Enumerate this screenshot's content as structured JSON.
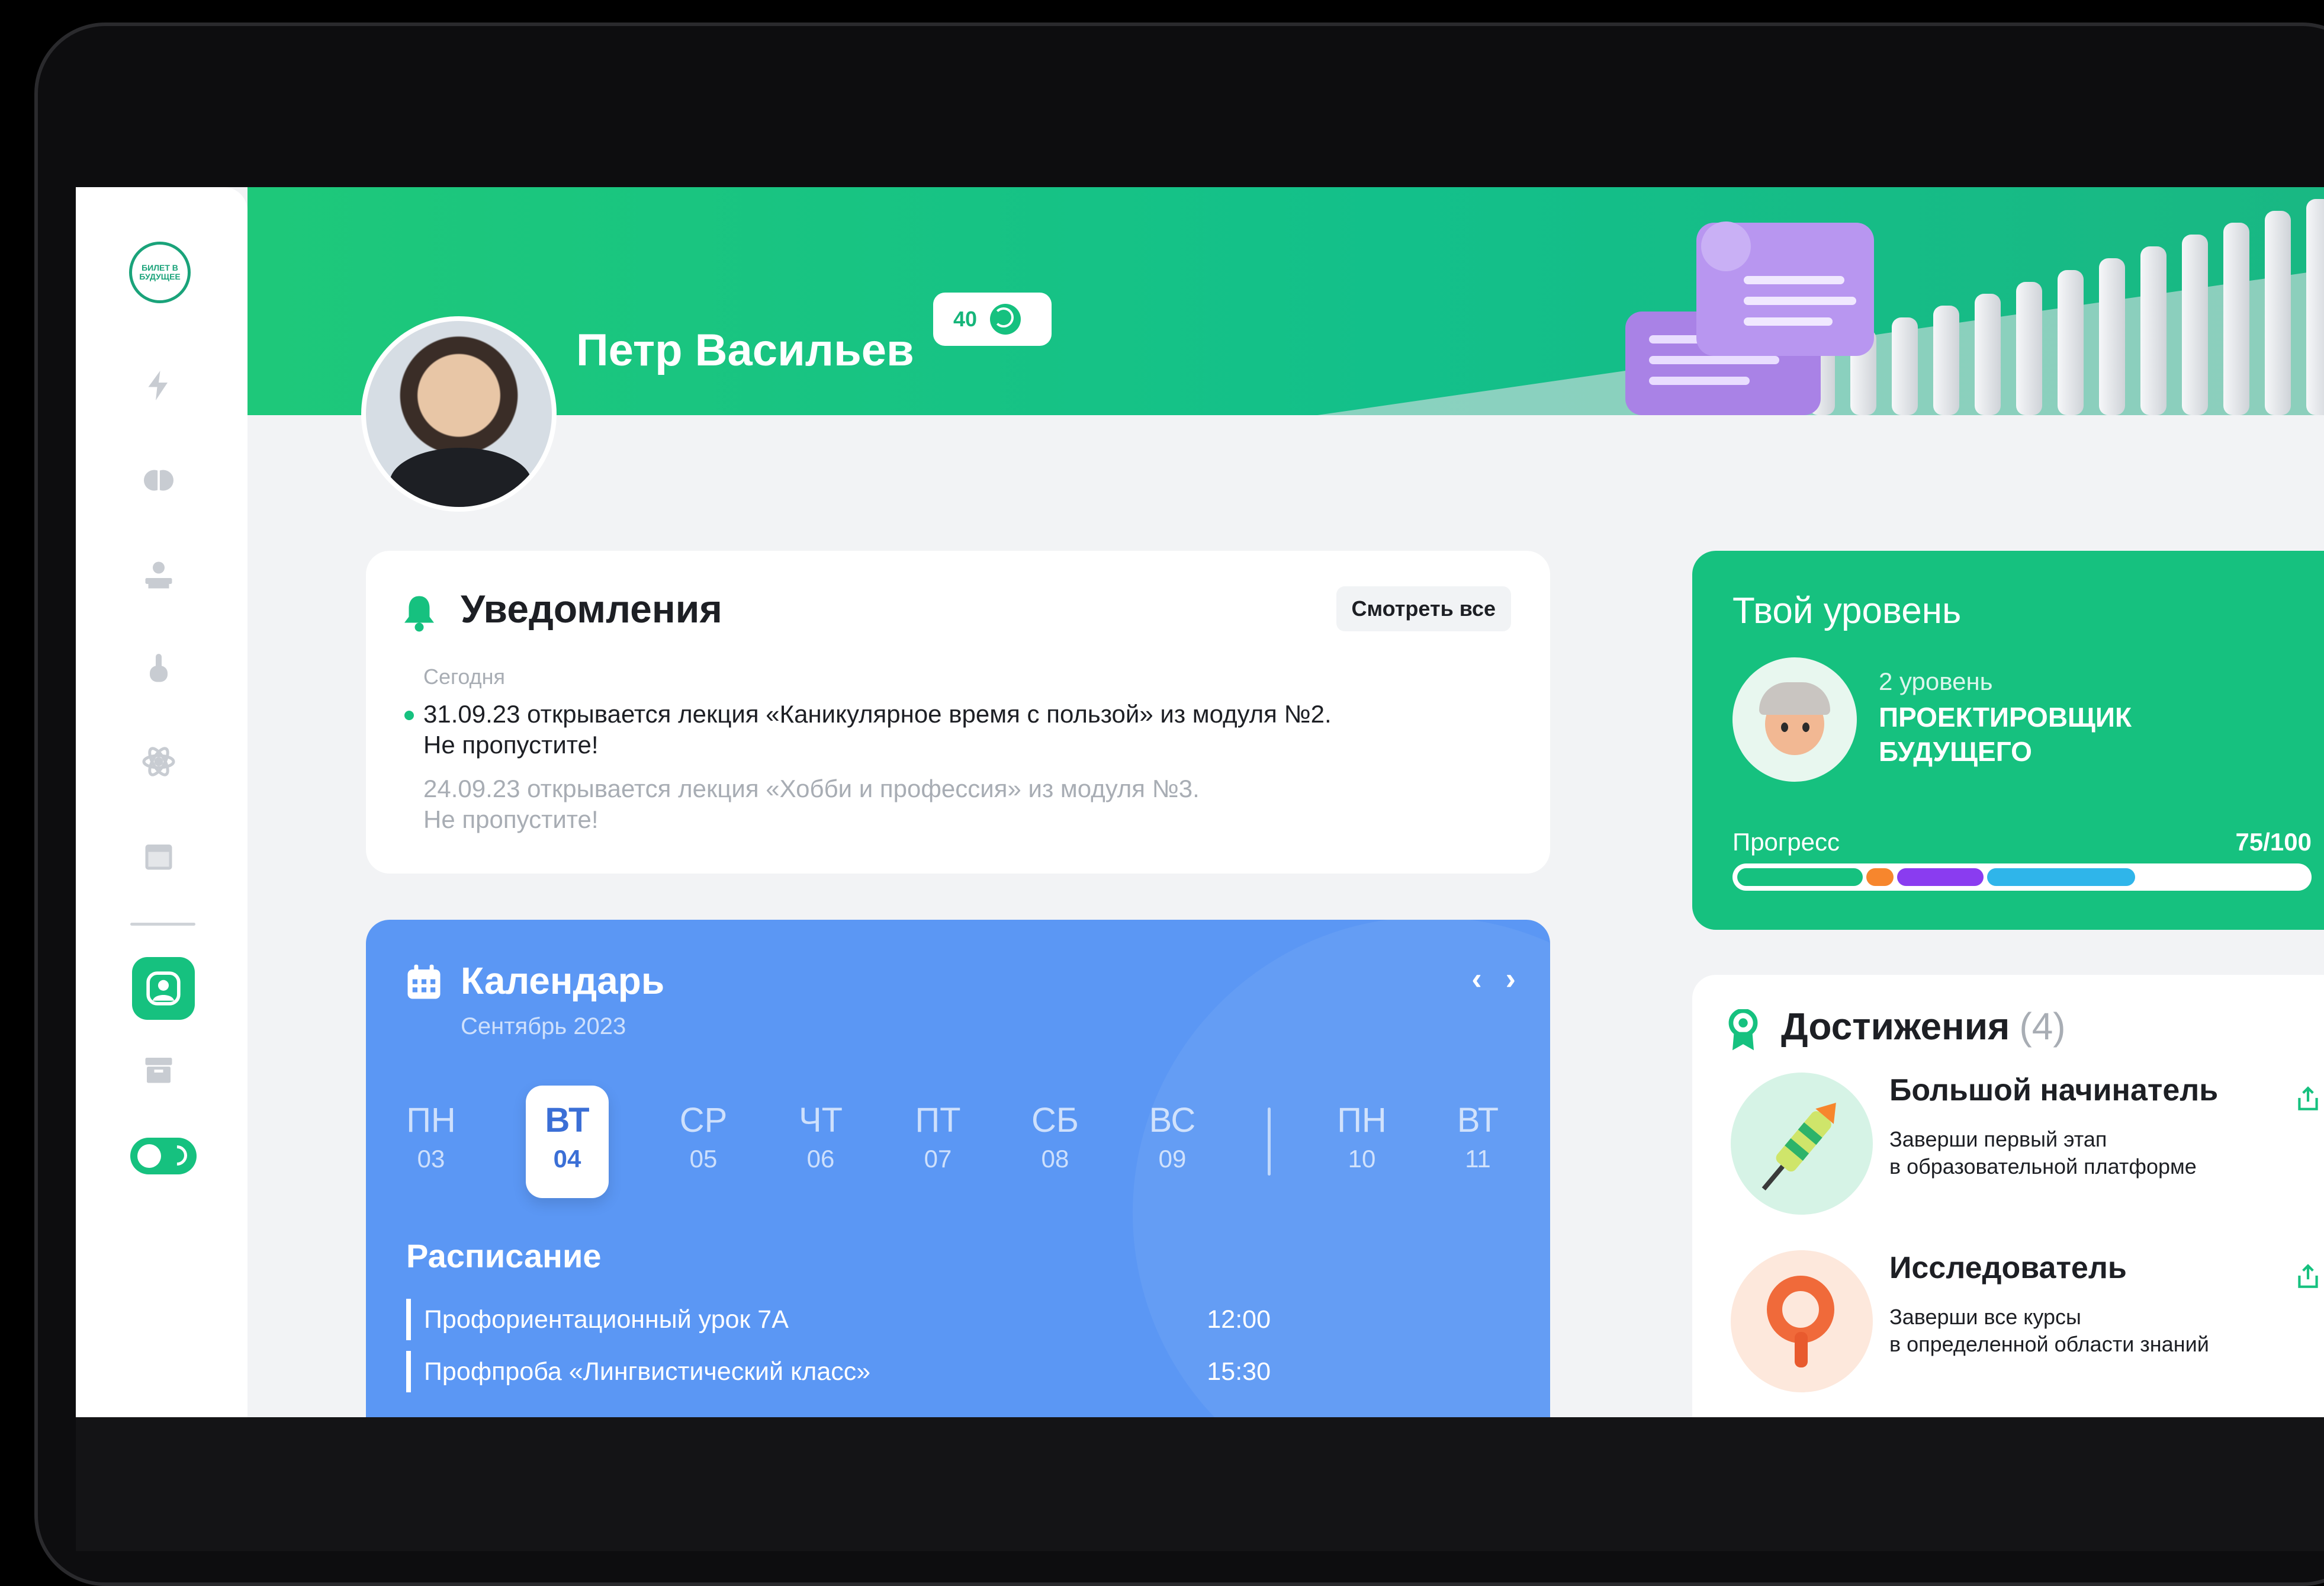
{
  "user": {
    "name": "Петр Васильев",
    "coins": "40"
  },
  "sidebar": {
    "logo": "БИЛЕТ В БУДУЩЕЕ",
    "icons": [
      "lightning-icon",
      "brain-icon",
      "pupil-icon",
      "hand-icon",
      "atom-icon",
      "calendar-icon",
      "profile-icon",
      "archive-icon",
      "theme-toggle"
    ]
  },
  "notifications": {
    "title": "Уведомления",
    "see_all": "Смотреть все",
    "today_label": "Сегодня",
    "items": [
      {
        "line1": "31.09.23 открывается лекция «Каникулярное время с пользой» из модуля №2.",
        "line2": "Не пропустите!",
        "unread": true
      },
      {
        "line1": "24.09.23 открывается лекция «Хобби и профессия» из модуля №3.",
        "line2": "Не пропустите!",
        "unread": false
      }
    ]
  },
  "calendar": {
    "title": "Календарь",
    "month": "Сентябрь 2023",
    "days": [
      {
        "name": "ПН",
        "date": "03"
      },
      {
        "name": "ВТ",
        "date": "04",
        "active": true
      },
      {
        "name": "СР",
        "date": "05"
      },
      {
        "name": "ЧТ",
        "date": "06"
      },
      {
        "name": "ПТ",
        "date": "07"
      },
      {
        "name": "СБ",
        "date": "08"
      },
      {
        "name": "ВС",
        "date": "09"
      },
      {
        "name": "ПН",
        "date": "10"
      },
      {
        "name": "ВТ",
        "date": "11"
      }
    ],
    "schedule_title": "Расписание",
    "schedule": [
      {
        "title": "Профориентационный урок 7А",
        "time": "12:00"
      },
      {
        "title": "Профпроба «Лингвистический класс»",
        "time": "15:30"
      }
    ]
  },
  "level": {
    "title": "Твой уровень",
    "level_label": "2 уровень",
    "level_name": "ПРОЕКТИРОВЩИК БУДУЩЕГО",
    "progress_label": "Прогресс",
    "progress_value": "75/100",
    "progress_fraction": 0.75,
    "colors": {
      "green": "#16c17f",
      "orange": "#f7862d",
      "purple": "#8a3cf0",
      "blue": "#2fb5ea"
    }
  },
  "achievements": {
    "title": "Достижения",
    "count": "(4)",
    "items": [
      {
        "name": "Большой начинатель",
        "desc1": "Заверши первый этап",
        "desc2": "в образовательной платформе",
        "icon": "rocket-icon"
      },
      {
        "name": "Исследователь",
        "desc1": "Заверши все курсы",
        "desc2": "в определенной области знаний",
        "icon": "magnifier-icon"
      }
    ]
  }
}
